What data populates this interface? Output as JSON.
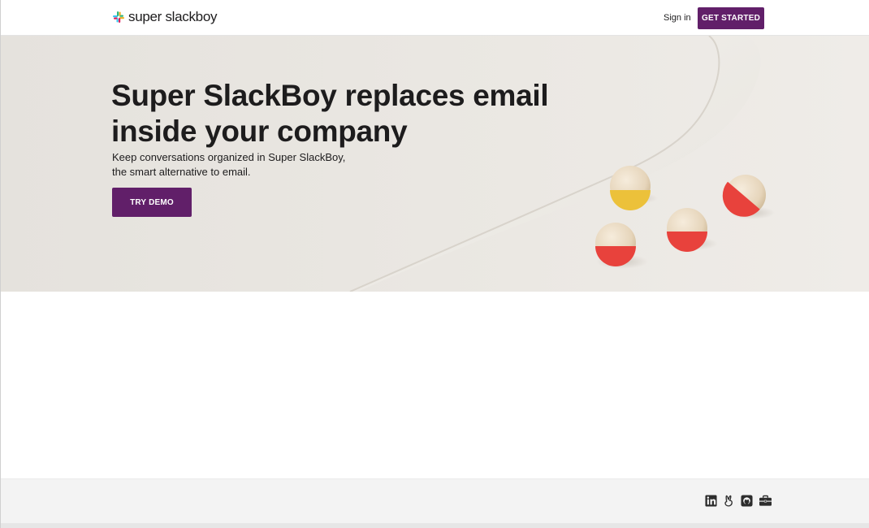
{
  "header": {
    "logo_text": "super slackboy",
    "signin_label": "Sign in",
    "cta_label": "GET STARTED"
  },
  "hero": {
    "title": "Super SlackBoy replaces email inside your company",
    "subtitle_line1": "Keep conversations organized in Super SlackBoy,",
    "subtitle_line2": "the smart alternative to email.",
    "demo_label": "TRY DEMO"
  },
  "footer": {
    "social_icons": [
      "linkedin-icon",
      "angellist-icon",
      "github-icon",
      "briefcase-icon"
    ]
  },
  "colors": {
    "brand_purple": "#611f69",
    "hero_bg": "#e9e6e1",
    "footer_bg": "#f3f3f3",
    "ball_red": "#e8423c",
    "ball_yellow": "#ecc13a"
  }
}
